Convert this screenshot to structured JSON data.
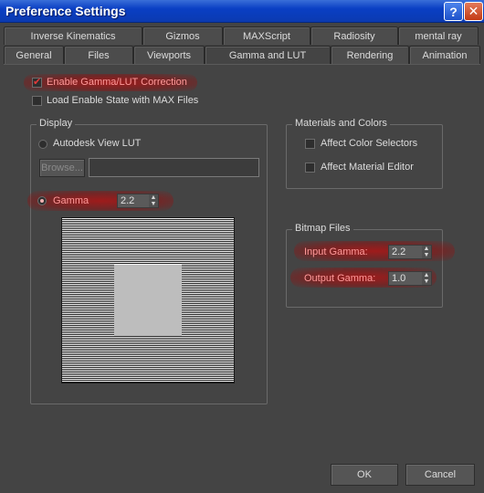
{
  "window": {
    "title": "Preference Settings",
    "help_glyph": "?",
    "close_glyph": "✕"
  },
  "tabs": {
    "row1": [
      "Inverse Kinematics",
      "Gizmos",
      "MAXScript",
      "Radiosity",
      "mental ray"
    ],
    "row2": [
      "General",
      "Files",
      "Viewports",
      "Gamma and LUT",
      "Rendering",
      "Animation"
    ],
    "active": "Gamma and LUT"
  },
  "options": {
    "enable_gamma": {
      "label": "Enable Gamma/LUT Correction",
      "checked": true,
      "mark": "✔"
    },
    "load_state": {
      "label": "Load Enable State with MAX Files",
      "checked": false
    }
  },
  "display": {
    "title": "Display",
    "lut_label": "Autodesk View LUT",
    "browse_label": "Browse...",
    "lut_path": "",
    "gamma_label": "Gamma",
    "gamma_value": "2.2",
    "selected": "Gamma"
  },
  "materials": {
    "title": "Materials and Colors",
    "affect_color": "Affect Color Selectors",
    "affect_material": "Affect Material Editor"
  },
  "bitmap": {
    "title": "Bitmap Files",
    "input_label": "Input Gamma:",
    "input_value": "2.2",
    "output_label": "Output Gamma:",
    "output_value": "1.0"
  },
  "footer": {
    "ok_label": "OK",
    "cancel_label": "Cancel"
  },
  "spinner": {
    "up": "▲",
    "down": "▼"
  },
  "colors": {
    "highlight": "#b01414",
    "background": "#444444",
    "titlebar": "#0a3fc4"
  }
}
